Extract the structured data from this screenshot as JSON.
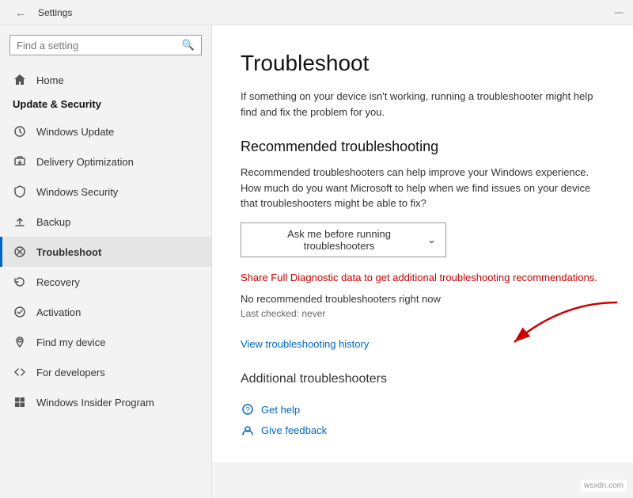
{
  "titleBar": {
    "title": "Settings",
    "minimizeBtn": "—"
  },
  "sidebar": {
    "searchPlaceholder": "Find a setting",
    "sectionTitle": "Update & Security",
    "homeLabel": "Home",
    "items": [
      {
        "id": "windows-update",
        "label": "Windows Update",
        "icon": "↻"
      },
      {
        "id": "delivery-optimization",
        "label": "Delivery Optimization",
        "icon": "⬇"
      },
      {
        "id": "windows-security",
        "label": "Windows Security",
        "icon": "🛡"
      },
      {
        "id": "backup",
        "label": "Backup",
        "icon": "⬆"
      },
      {
        "id": "troubleshoot",
        "label": "Troubleshoot",
        "icon": "🔧",
        "active": true
      },
      {
        "id": "recovery",
        "label": "Recovery",
        "icon": "↩"
      },
      {
        "id": "activation",
        "label": "Activation",
        "icon": "✓"
      },
      {
        "id": "find-my-device",
        "label": "Find my device",
        "icon": "📍"
      },
      {
        "id": "for-developers",
        "label": "For developers",
        "icon": "⚙"
      },
      {
        "id": "windows-insider",
        "label": "Windows Insider Program",
        "icon": "⊞"
      }
    ]
  },
  "content": {
    "pageTitle": "Troubleshoot",
    "introText": "If something on your device isn't working, running a troubleshooter might help find and fix the problem for you.",
    "recommendedSection": {
      "title": "Recommended troubleshooting",
      "desc": "Recommended troubleshooters can help improve your Windows experience. How much do you want Microsoft to help when we find issues on your device that troubleshooters might be able to fix?",
      "dropdownLabel": "Ask me before running troubleshooters",
      "shareLink": "Share Full Diagnostic data to get additional troubleshooting recommendations.",
      "noTroubleshooters": "No recommended troubleshooters right now",
      "lastChecked": "Last checked: never"
    },
    "viewHistoryLink": "View troubleshooting history",
    "additionalSection": "Additional troubleshooters",
    "helpLinks": [
      {
        "id": "get-help",
        "label": "Get help",
        "icon": "?"
      },
      {
        "id": "give-feedback",
        "label": "Give feedback",
        "icon": "★"
      }
    ]
  },
  "watermark": "wsxdn.com"
}
